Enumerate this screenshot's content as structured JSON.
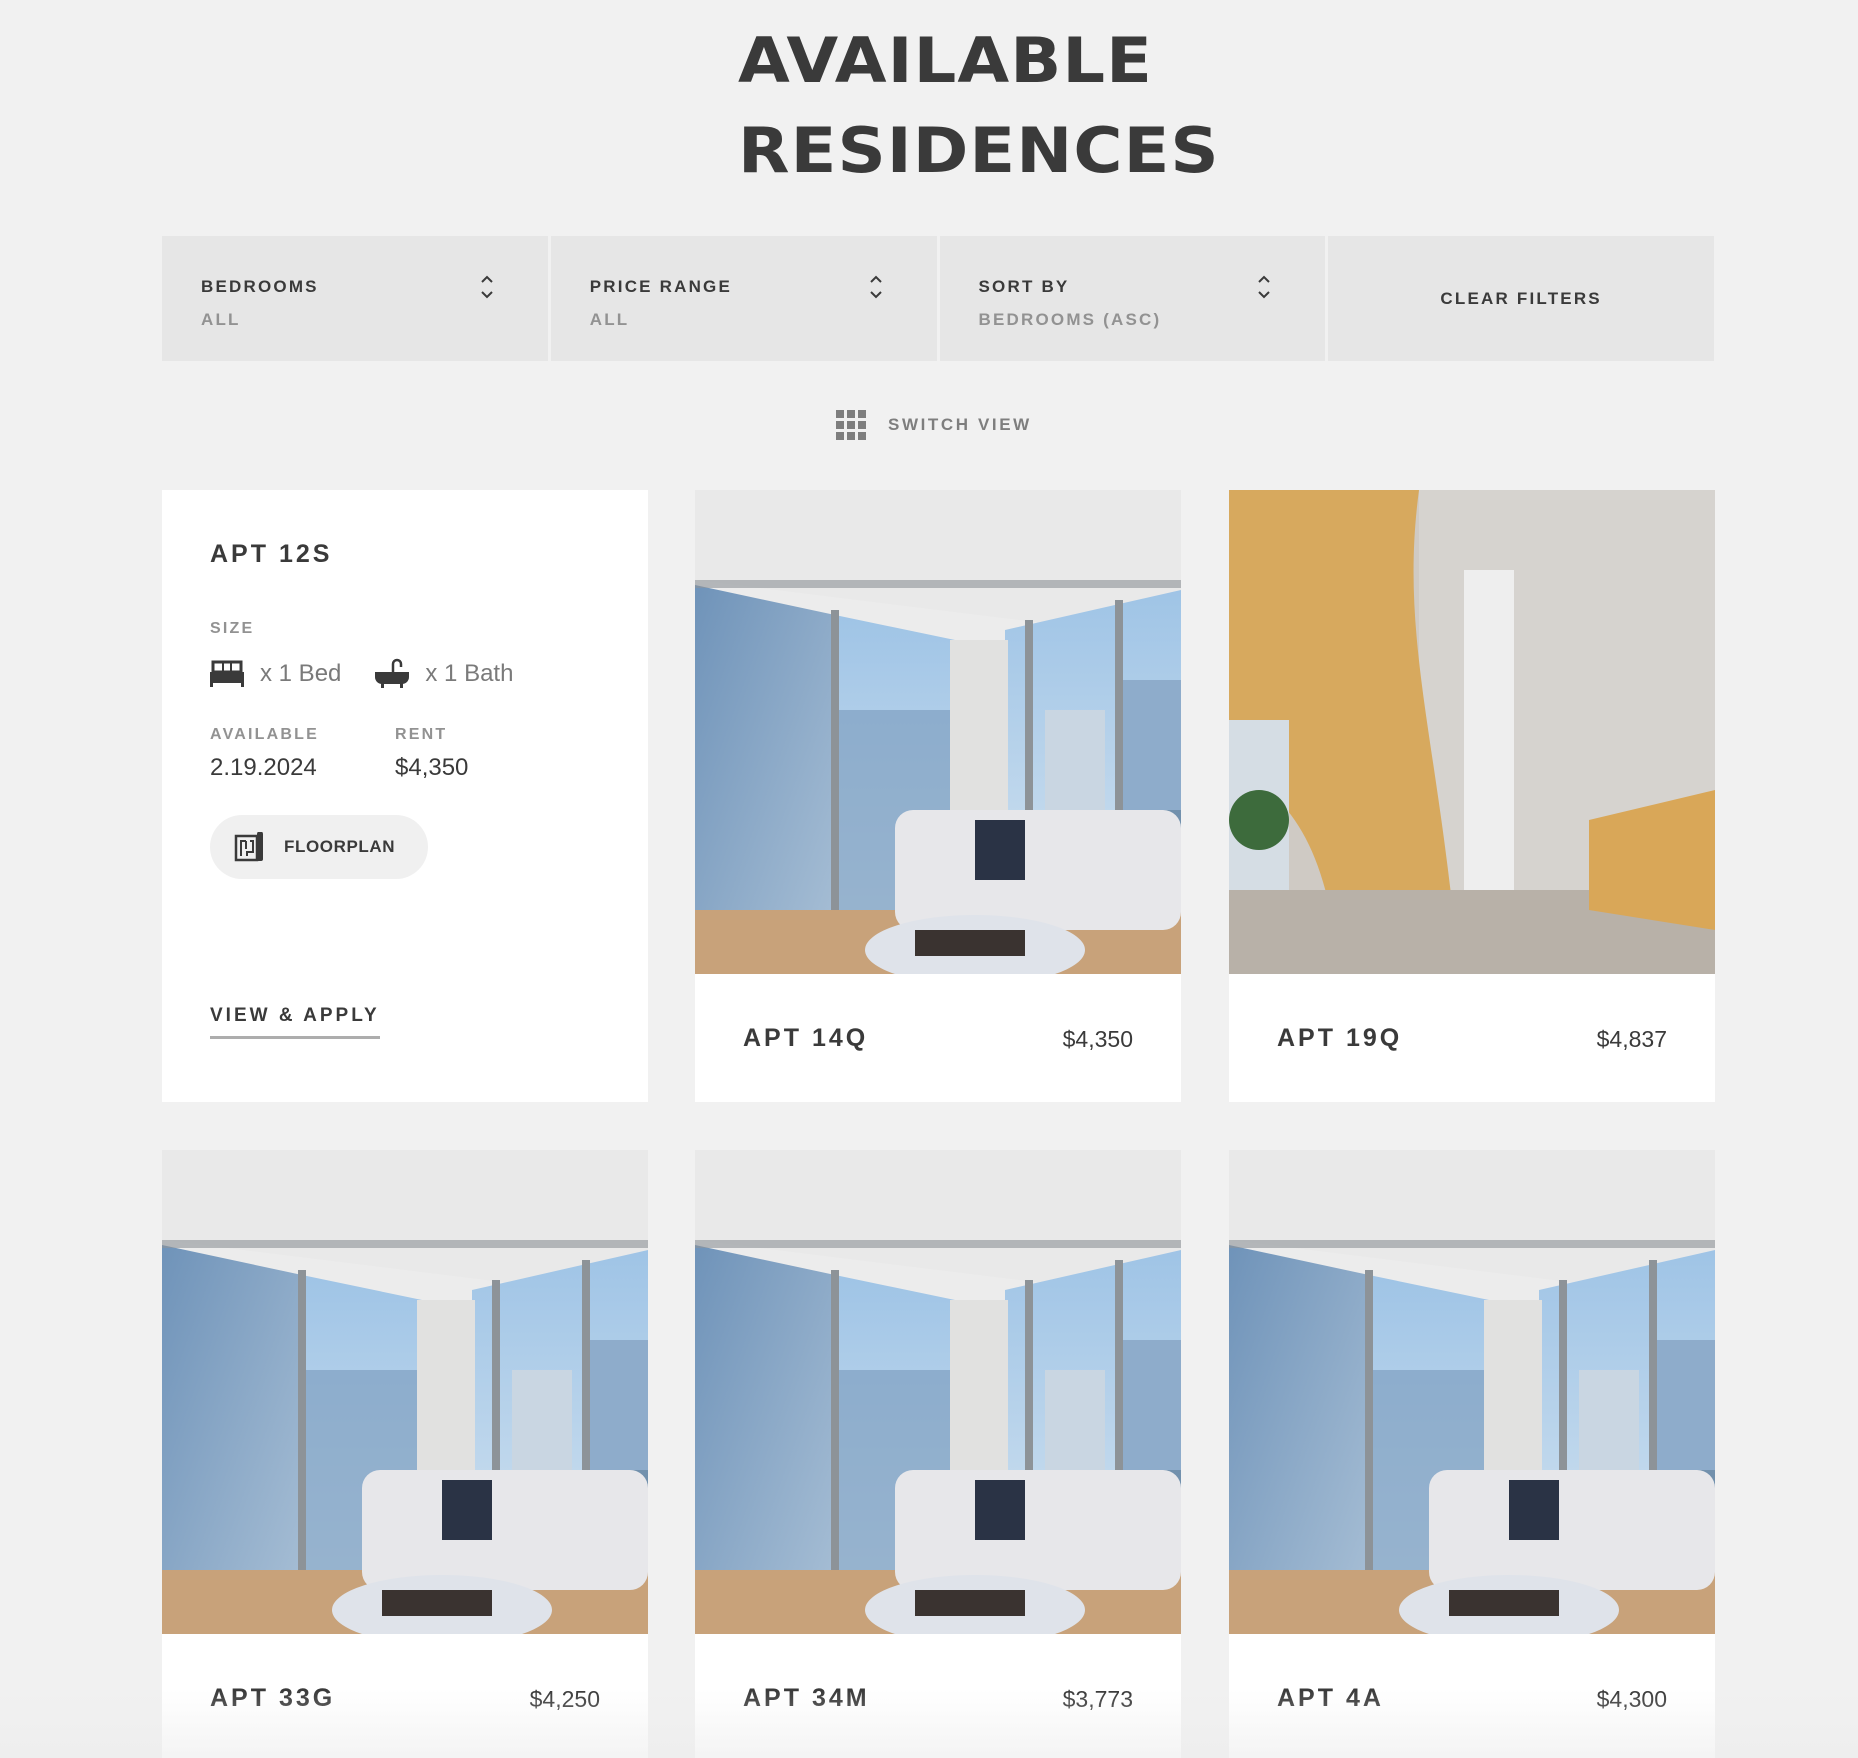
{
  "page": {
    "title_line1": "AVAILABLE",
    "title_line2": "RESIDENCES"
  },
  "filters": {
    "bedrooms": {
      "label": "BEDROOMS",
      "value": "ALL"
    },
    "price_range": {
      "label": "PRICE RANGE",
      "value": "ALL"
    },
    "sort_by": {
      "label": "SORT BY",
      "value": "BEDROOMS (ASC)"
    },
    "clear_label": "CLEAR FILTERS"
  },
  "switch_view": {
    "label": "SWITCH VIEW",
    "icon": "grid-icon"
  },
  "detail": {
    "title": "APT 12S",
    "size_label": "SIZE",
    "bed_text": "x 1 Bed",
    "bath_text": "x 1 Bath",
    "available_label": "AVAILABLE",
    "available_value": "2.19.2024",
    "rent_label": "RENT",
    "rent_value": "$4,350",
    "floorplan_label": "FLOORPLAN",
    "view_apply_label": "VIEW & APPLY"
  },
  "listings": [
    {
      "name": "APT 14Q",
      "price": "$4,350",
      "photo": "living-room"
    },
    {
      "name": "APT 19Q",
      "price": "$4,837",
      "photo": "lobby"
    },
    {
      "name": "APT 33G",
      "price": "$4,250",
      "photo": "living-room"
    },
    {
      "name": "APT 34M",
      "price": "$3,773",
      "photo": "living-room"
    },
    {
      "name": "APT 4A",
      "price": "$4,300",
      "photo": "living-room"
    }
  ],
  "colors": {
    "background": "#f1f1f1",
    "filter_bg": "#e6e6e6",
    "text_dark": "#3a3a3a",
    "text_muted": "#929292"
  }
}
